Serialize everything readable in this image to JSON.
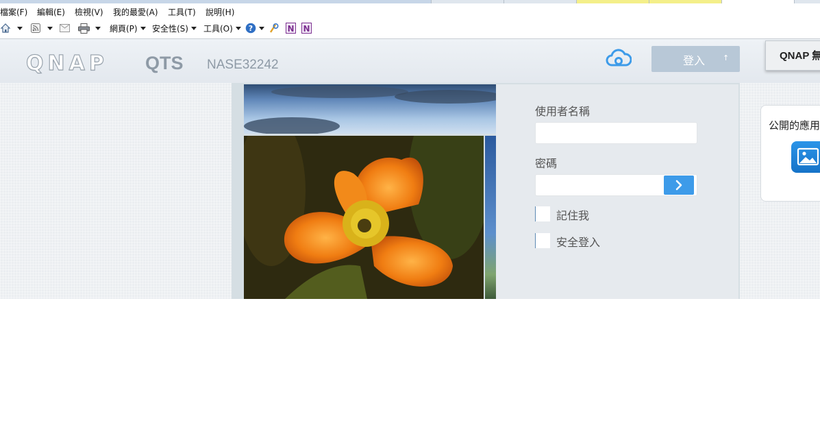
{
  "browser": {
    "menu": [
      "檔案(F)",
      "編輯(E)",
      "檢視(V)",
      "我的最愛(A)",
      "工具(T)",
      "說明(H)"
    ],
    "toolbar": {
      "page_label": "網頁(P)",
      "safety_label": "安全性(S)",
      "tools_label": "工具(O)"
    }
  },
  "header": {
    "logo_text": "QNAP",
    "product": "QTS",
    "hostname": "NASE32242",
    "login_label": "登入",
    "login_arrow": "↑",
    "qnap_tab_label": "QNAP 無"
  },
  "login_form": {
    "username_label": "使用者名稱",
    "username_value": "",
    "password_label": "密碼",
    "password_value": "",
    "submit_glyph": "›",
    "remember_label": "記住我",
    "secure_login_label": "安全登入"
  },
  "public_apps": {
    "title": "公開的應用"
  },
  "colors": {
    "accent_blue": "#3d9be9",
    "header_text": "#8e9aa6",
    "login_button": "#b8c8d7"
  }
}
